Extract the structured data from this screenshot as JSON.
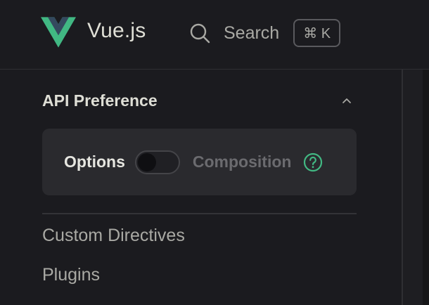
{
  "header": {
    "brand": "Vue.js",
    "logo_icon": "vue-logo",
    "search": {
      "icon": "search-icon",
      "label": "Search",
      "shortcut": "⌘ K"
    }
  },
  "sidebar": {
    "api_preference": {
      "title": "API Preference",
      "collapse_icon": "chevron-up-icon",
      "option_left": "Options",
      "option_right": "Composition",
      "toggle_state": "off",
      "help_icon": "question-circle-icon"
    },
    "items": [
      {
        "label": "Custom Directives"
      },
      {
        "label": "Plugins"
      }
    ]
  },
  "colors": {
    "background": "#1b1b1f",
    "vue_green": "#42b883",
    "vue_dark": "#35495e"
  }
}
